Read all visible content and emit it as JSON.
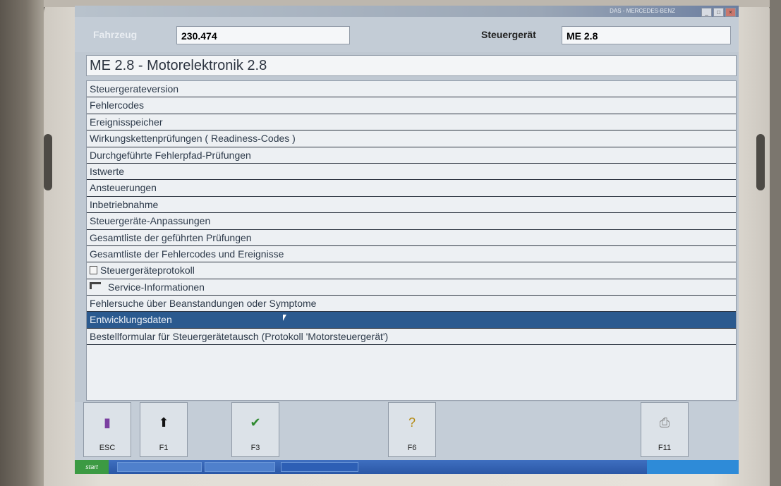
{
  "window": {
    "title": "DAS - MERCEDES-BENZ"
  },
  "header": {
    "vehicle_label": "Fahrzeug",
    "vehicle_value": "230.474",
    "ecu_label": "Steuergerät",
    "ecu_value": "ME 2.8"
  },
  "module_title": "ME 2.8 - Motorelektronik 2.8",
  "menu": {
    "selected_index": 15,
    "items": [
      "Steuergerateversion",
      "Fehlercodes",
      "Ereignisspeicher",
      "Wirkungskettenprüfungen ( Readiness-Codes )",
      "Durchgeführte Fehlerpfad-Prüfungen",
      "Istwerte",
      "Ansteuerungen",
      "Inbetriebnahme",
      "Steuergeräte-Anpassungen",
      "Gesamtliste der geführten Prüfungen",
      "Gesamtliste der Fehlercodes und Ereignisse",
      "Steuergeräteprotokoll",
      "Service-Informationen",
      "Fehlersuche über Beanstandungen oder Symptome",
      "Entwicklungsdaten",
      "Bestellformular für Steuergerätetausch (Protokoll 'Motorsteuergerät')"
    ]
  },
  "function_keys": [
    {
      "label": "ESC",
      "icon": "door-icon"
    },
    {
      "label": "F1",
      "icon": "arrow-up-icon"
    },
    {
      "label": "F3",
      "icon": "checkmark-icon"
    },
    {
      "label": "F6",
      "icon": "question-icon"
    },
    {
      "label": "F11",
      "icon": "printer-icon"
    }
  ],
  "taskbar": {
    "start_label": "start"
  },
  "colors": {
    "selection": "#2b5a8f",
    "background": "#c3ccd6"
  }
}
